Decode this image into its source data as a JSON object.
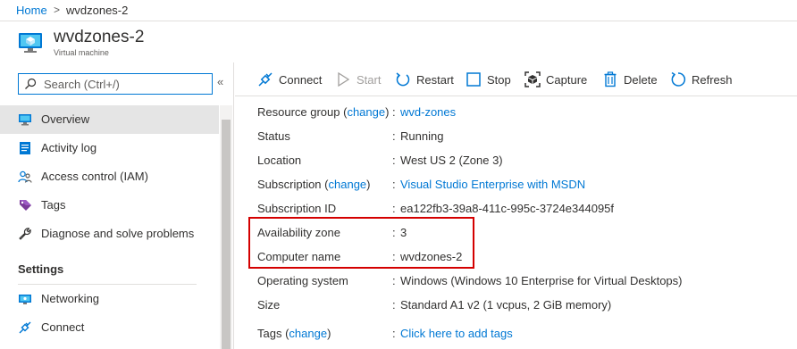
{
  "breadcrumb": {
    "home": "Home",
    "separator": ">",
    "current": "wvdzones-2"
  },
  "header": {
    "title": "wvdzones-2",
    "subtitle": "Virtual machine",
    "icon": "virtual-machine-icon"
  },
  "colors": {
    "accent": "#0078d4",
    "highlight_border": "#d40000",
    "active_nav": "#e5e5e5"
  },
  "sidebar": {
    "search": {
      "placeholder": "Search (Ctrl+/)",
      "icon": "search-icon"
    },
    "collapse": "«",
    "items": [
      {
        "label": "Overview",
        "icon": "monitor-icon",
        "active": true
      },
      {
        "label": "Activity log",
        "icon": "activity-log-icon"
      },
      {
        "label": "Access control (IAM)",
        "icon": "people-icon"
      },
      {
        "label": "Tags",
        "icon": "tag-icon"
      },
      {
        "label": "Diagnose and solve problems",
        "icon": "wrench-icon"
      }
    ],
    "section": "Settings",
    "settings_items": [
      {
        "label": "Networking",
        "icon": "network-icon"
      },
      {
        "label": "Connect",
        "icon": "plug-icon"
      }
    ]
  },
  "toolbar": {
    "connect": "Connect",
    "start": "Start",
    "restart": "Restart",
    "stop": "Stop",
    "capture": "Capture",
    "delete": "Delete",
    "refresh": "Refresh"
  },
  "properties": [
    {
      "label": "Resource group",
      "change": "change",
      "value": "wvd-zones",
      "value_link": true
    },
    {
      "label": "Status",
      "value": "Running"
    },
    {
      "label": "Location",
      "value": "West US 2 (Zone 3)"
    },
    {
      "label": "Subscription",
      "change": "change",
      "value": "Visual Studio Enterprise with MSDN",
      "value_link": true
    },
    {
      "label": "Subscription ID",
      "value": "ea122fb3-39a8-411c-995c-3724e344095f"
    },
    {
      "label": "Availability zone",
      "value": "3"
    },
    {
      "label": "Computer name",
      "value": "wvdzones-2"
    },
    {
      "label": "Operating system",
      "value": "Windows (Windows 10 Enterprise for Virtual Desktops)"
    },
    {
      "label": "Size",
      "value": "Standard A1 v2 (1 vcpus, 2 GiB memory)"
    },
    {
      "label": "Tags",
      "change": "change",
      "value": "Click here to add tags",
      "value_link": true
    }
  ],
  "property_separator": ":"
}
